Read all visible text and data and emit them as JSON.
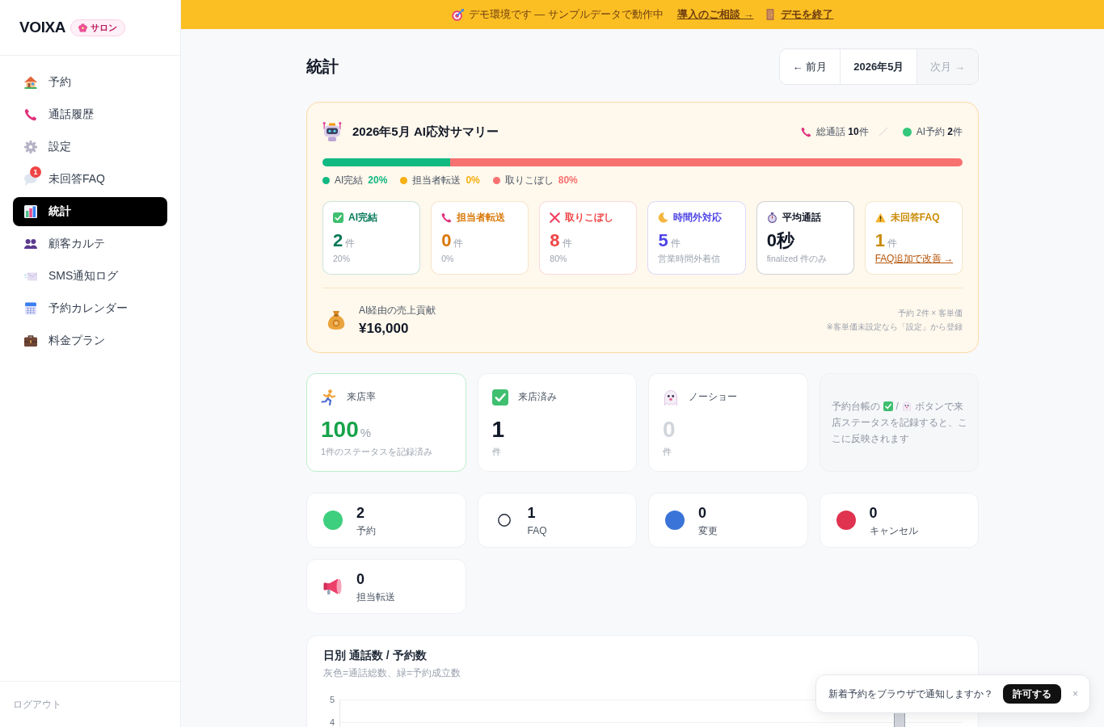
{
  "sidebar": {
    "brand": "VOIXA",
    "brand_badge": "サロン",
    "items": [
      {
        "label": "予約",
        "selected": false
      },
      {
        "label": "通話履歴",
        "selected": false
      },
      {
        "label": "設定",
        "selected": false
      },
      {
        "label": "未回答FAQ",
        "selected": false,
        "badge": "1"
      },
      {
        "label": "統計",
        "selected": true
      },
      {
        "label": "顧客カルテ",
        "selected": false
      },
      {
        "label": "SMS通知ログ",
        "selected": false
      },
      {
        "label": "予約カレンダー",
        "selected": false
      },
      {
        "label": "料金プラン",
        "selected": false
      }
    ],
    "logout": "ログアウト"
  },
  "demo_banner": {
    "text": "デモ環境です — サンプルデータで動作中",
    "consult_link": "導入のご相談 →",
    "exit_link": "デモを終了"
  },
  "header": {
    "title": "統計",
    "month_nav": [
      {
        "label": "← 前月",
        "disabled": false
      },
      {
        "label": "2026年5月",
        "disabled": false
      },
      {
        "label": "次月 →",
        "disabled": true
      }
    ]
  },
  "summary": {
    "title": "2026年5月 AI応対サマリー",
    "total_calls": "総通話 **10**件",
    "ai_bookings": "AI予約 **2**件",
    "segments": [
      {
        "label": "AI完結",
        "value": "20%",
        "level": 0.2,
        "color": "#10b981"
      },
      {
        "label": "担当者転送",
        "value": "0%",
        "color": "#f5b014"
      },
      {
        "label": "取りこぼし",
        "value": "80%",
        "level": 0.8,
        "color": "#f87171"
      }
    ],
    "cards": [
      {
        "label": "AI完結",
        "value": "2",
        "unit": "件",
        "sub": "20%",
        "color": "#047857"
      },
      {
        "label": "担当者転送",
        "value": "0",
        "unit": "件",
        "sub": "0%",
        "color": "#d97706"
      },
      {
        "label": "取りこぼし",
        "value": "8",
        "unit": "件",
        "sub": "80%",
        "color": "#ef4444"
      },
      {
        "label": "時間外対応",
        "value": "5",
        "unit": "件",
        "sub": "営業時間外着信",
        "color": "#4f46e5"
      },
      {
        "label": "平均通話",
        "value": "0秒",
        "sub": "finalized 件のみ",
        "color": "#111827"
      },
      {
        "label": "未回答FAQ",
        "value": "1",
        "unit": "件",
        "link": "FAQ追加で改善 →",
        "color": "#ca8a04"
      }
    ],
    "revenue": {
      "label": "AI経由の売上貢献",
      "value": "¥16,000",
      "formula": "予約 2件 × 客単価",
      "note": "※客単価未設定なら「設定」から登録"
    }
  },
  "visit_cards": [
    {
      "kind": "rate",
      "label": "来店率",
      "value": "100",
      "unit": "%",
      "sub": "1件のステータスを記録済み",
      "color": "#16a34a"
    },
    {
      "kind": "count",
      "label": "来店済み",
      "value": "1",
      "unit": "件",
      "color": "#111827"
    },
    {
      "kind": "count",
      "label": "ノーショー",
      "value": "0",
      "unit": "件",
      "color": "#d1d5db"
    },
    {
      "kind": "hint",
      "parts": [
        "予約台帳の",
        "/",
        "ボタンで来",
        "店ステータスを記録すると、ここに反映されます"
      ]
    }
  ],
  "counts": [
    {
      "kind": "dot",
      "color": "#3ecf7e",
      "value": "2",
      "label": "予約"
    },
    {
      "kind": "ring",
      "value": "1",
      "label": "FAQ"
    },
    {
      "kind": "dot",
      "color": "#3b74d8",
      "value": "0",
      "label": "変更"
    },
    {
      "kind": "dot",
      "color": "#e0334f",
      "value": "0",
      "label": "キャンセル"
    },
    {
      "kind": "megaphone",
      "value": "0",
      "label": "担当転送"
    }
  ],
  "daily_chart": {
    "title": "日別 通話数 / 予約数",
    "subtitle": "灰色=通話総数、緑=予約成立数",
    "y_tick_labels": [
      "5",
      "4"
    ]
  },
  "notification": {
    "text": "新着予約をブラウザで通知しますか？",
    "allow": "許可する",
    "close": "×"
  }
}
